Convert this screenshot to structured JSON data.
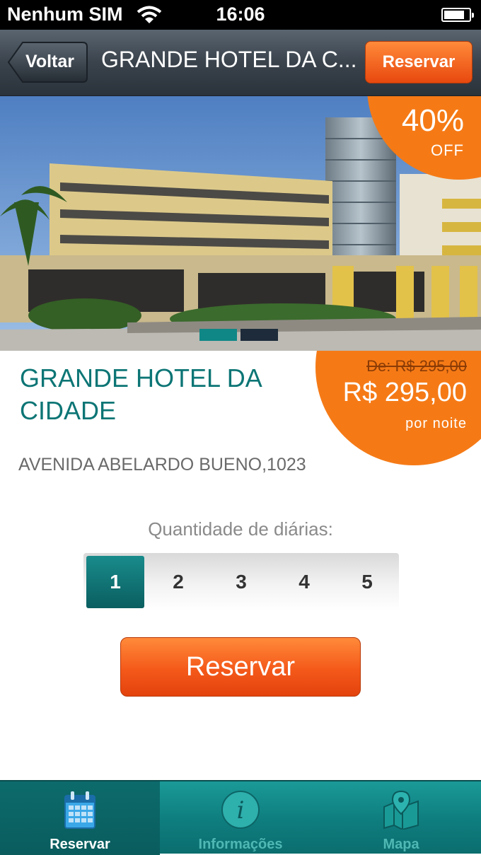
{
  "status_bar": {
    "carrier": "Nenhum SIM",
    "time": "16:06"
  },
  "nav": {
    "back_label": "Voltar",
    "title": "GRANDE HOTEL DA C...",
    "reserve_label": "Reservar"
  },
  "hero": {
    "discount_percent": "40%",
    "discount_off": "OFF",
    "pager": {
      "count": 2,
      "current": 0
    }
  },
  "hotel": {
    "name": "GRANDE HOTEL DA CIDADE",
    "address": "AVENIDA ABELARDO BUENO,1023",
    "old_price": "De: R$ 295,00",
    "price": "R$ 295,00",
    "per_night": "por noite"
  },
  "quantity": {
    "label": "Quantidade de diárias:",
    "options": [
      "1",
      "2",
      "3",
      "4",
      "5"
    ],
    "selected": "1"
  },
  "reserve_button": "Reservar",
  "tabs": [
    {
      "label": "Reservar",
      "icon": "calendar-icon",
      "active": true
    },
    {
      "label": "Informações",
      "icon": "info-icon",
      "active": false
    },
    {
      "label": "Mapa",
      "icon": "map-icon",
      "active": false
    }
  ],
  "colors": {
    "accent_teal": "#0d7575",
    "accent_orange": "#f57a16",
    "tab_bar": "#0f7f80"
  }
}
